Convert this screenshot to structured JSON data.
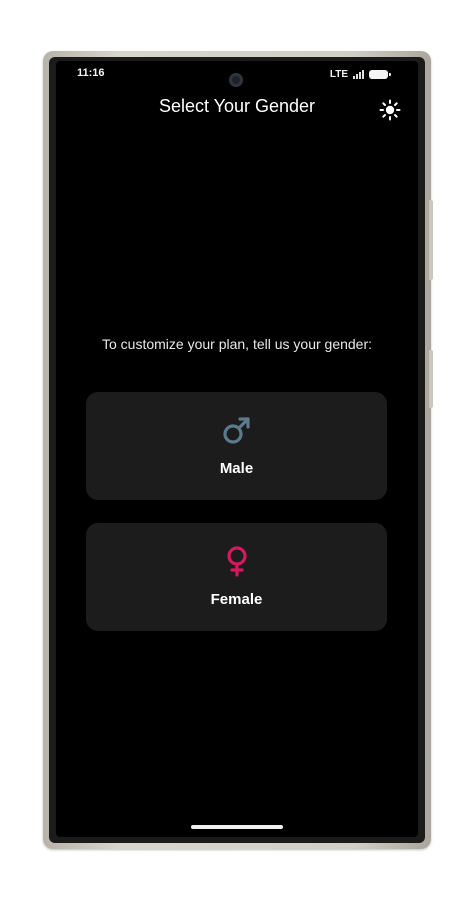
{
  "status_bar": {
    "time": "11:16",
    "network": "LTE",
    "signal_icon": "signal-icon",
    "battery_icon": "battery-icon"
  },
  "header": {
    "title": "Select Your Gender",
    "theme_toggle_icon": "sun-icon"
  },
  "main": {
    "prompt": "To customize your plan, tell us your gender:",
    "options": [
      {
        "label": "Male",
        "icon": "male-symbol-icon",
        "color": "#5b7a8c"
      },
      {
        "label": "Female",
        "icon": "female-symbol-icon",
        "color": "#d4195f"
      }
    ]
  },
  "colors": {
    "background": "#000000",
    "card": "#1c1c1d",
    "text": "#ffffff"
  }
}
